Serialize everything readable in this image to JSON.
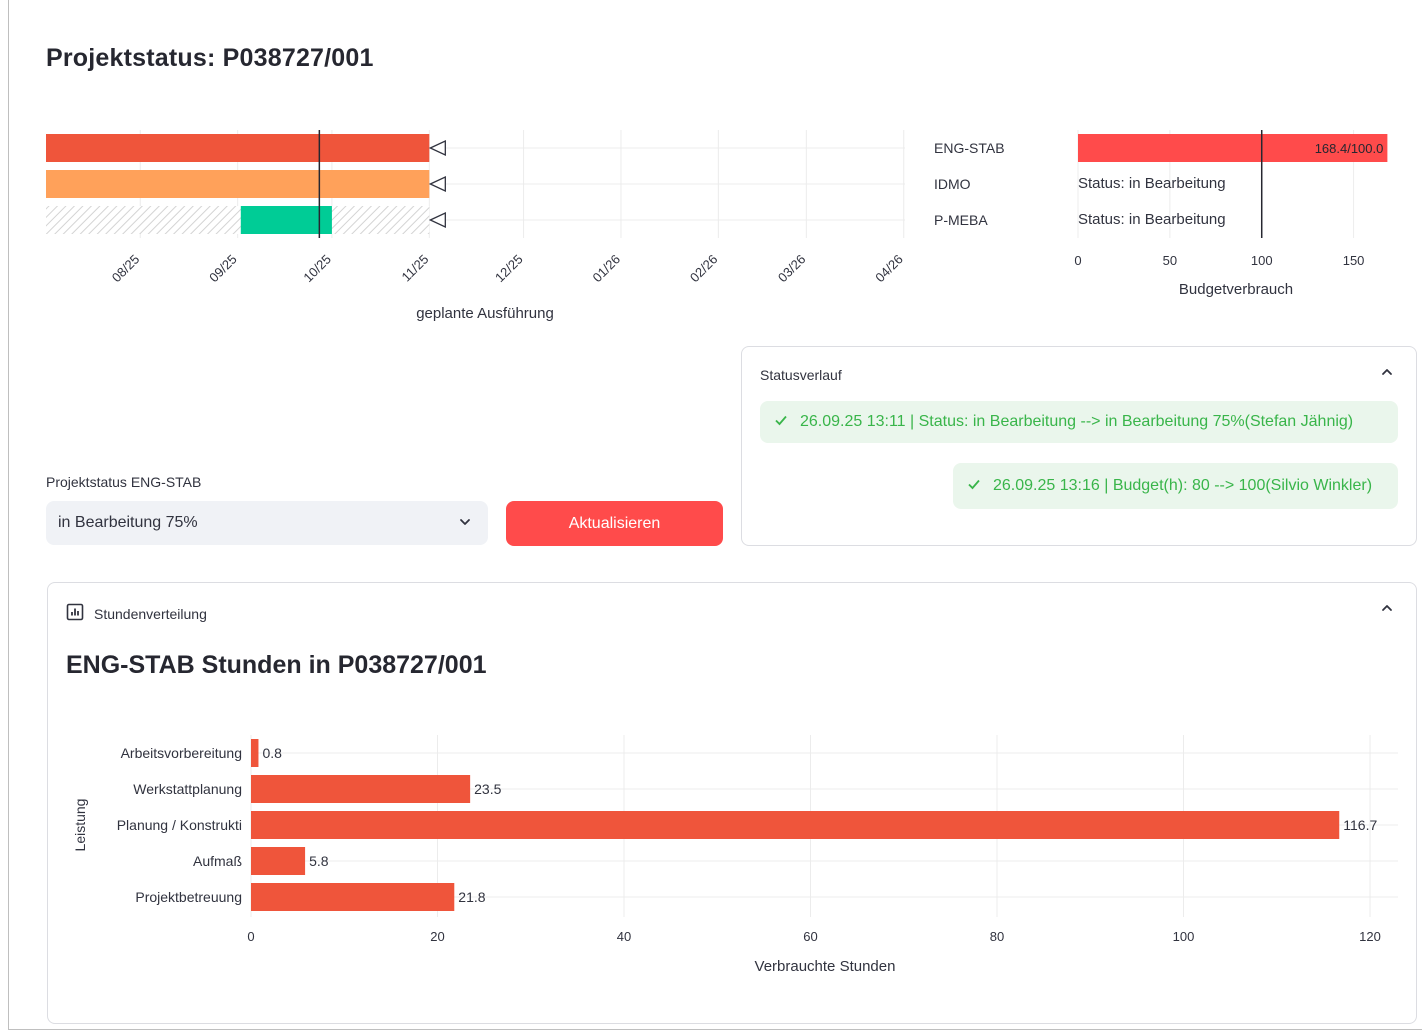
{
  "page": {
    "title": "Projektstatus: P038727/001"
  },
  "timeline_chart": {
    "rows": [
      {
        "name": "ENG-STAB",
        "color": "#ef553b",
        "start": "2025-07-01",
        "end": "2025-10-31",
        "hatched": false,
        "milestone": "2025-10-31"
      },
      {
        "name": "IDMO",
        "color": "#ffa15a",
        "start": "2025-07-01",
        "end": "2025-10-31",
        "hatched": false,
        "milestone": "2025-10-31"
      },
      {
        "name": "P-MEBA",
        "color": "#00cc96",
        "start": "2025-09-01",
        "end": "2025-09-30",
        "hatched": true,
        "hatch_start": "2025-07-01",
        "hatch_end": "2025-10-31",
        "milestone": "2025-10-31"
      }
    ],
    "today": "2025-09-26",
    "x_ticks": [
      "08/25",
      "09/25",
      "10/25",
      "11/25",
      "12/25",
      "01/26",
      "02/26",
      "03/26",
      "04/26"
    ],
    "xlabel": "geplante Ausführung"
  },
  "budget_chart": {
    "rows": [
      {
        "name": "ENG-STAB",
        "value": 168.4,
        "label": "168.4/100.0",
        "color": "#ff4b4b"
      },
      {
        "name": "IDMO",
        "value": null,
        "label": "Status: in Bearbeitung"
      },
      {
        "name": "P-MEBA",
        "value": null,
        "label": "Status: in Bearbeitung"
      }
    ],
    "reference": 100,
    "x_ticks": [
      0,
      50,
      100,
      150
    ],
    "xlim": [
      0,
      172
    ],
    "xlabel": "Budgetverbrauch"
  },
  "status_history": {
    "title": "Statusverlauf",
    "entries": [
      "26.09.25 13:11 | Status: in Bearbeitung --> in Bearbeitung 75%(Stefan Jähnig)",
      "26.09.25 13:16 | Budget(h): 80 --> 100(Silvio Winkler)"
    ],
    "success_color": "#39b54a"
  },
  "form": {
    "select_label": "Projektstatus ENG-STAB",
    "select_value": "in Bearbeitung 75%",
    "button_label": "Aktualisieren"
  },
  "hours_section": {
    "expander_title": "Stundenverteilung",
    "title": "ENG-STAB Stunden in P038727/001"
  },
  "chart_data": {
    "type": "bar",
    "orientation": "horizontal",
    "categories": [
      "Arbeitsvorbereitung",
      "Werkstattplanung",
      "Planung / Konstrukti",
      "Aufmaß",
      "Projektbetreuung"
    ],
    "values": [
      0.8,
      23.5,
      116.7,
      5.8,
      21.8
    ],
    "value_labels": [
      "0.8",
      "23.5",
      "116.7",
      "5.8",
      "21.8"
    ],
    "xlabel": "Verbrauchte Stunden",
    "ylabel": "Leistung",
    "xlim": [
      0,
      123
    ],
    "x_ticks": [
      0,
      20,
      40,
      60,
      80,
      100,
      120
    ],
    "color": "#ef553b",
    "grid": true
  }
}
